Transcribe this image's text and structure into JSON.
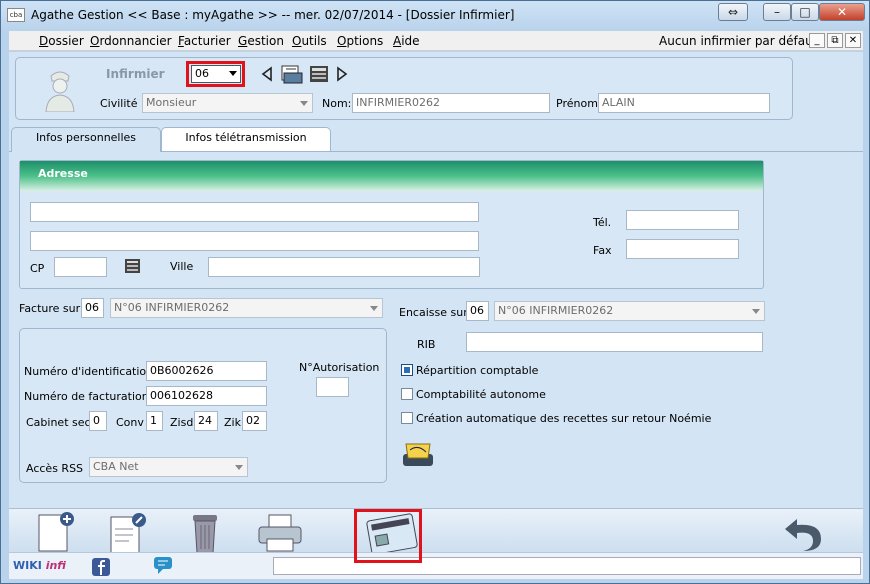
{
  "window": {
    "app_icon": "cba",
    "title": "Agathe Gestion << Base : myAgathe >>   --   mer. 02/07/2014  - [Dossier Infirmier]",
    "extra_button": "⇔",
    "minimize": "–",
    "maximize": "□",
    "close": "✕"
  },
  "menu": {
    "items": [
      {
        "first": "D",
        "rest": "ossier"
      },
      {
        "first": "O",
        "rest": "rdonnancier"
      },
      {
        "first": "F",
        "rest": "acturier"
      },
      {
        "first": "G",
        "rest": "estion"
      },
      {
        "first": "O",
        "rest": "utils"
      },
      {
        "first": "O",
        "rest": "ptions"
      },
      {
        "first": "A",
        "rest": "ide"
      }
    ],
    "default_nurse": "Aucun infirmier par défaut",
    "mdi_min": "_",
    "mdi_restore": "⧉",
    "mdi_close": "✕"
  },
  "header": {
    "title_label": "Infirmier",
    "number": "06",
    "civilite_label": "Civilité",
    "civilite_value": "Monsieur",
    "nom_label": "Nom:",
    "nom_value": "INFIRMIER0262",
    "prenom_label": "Prénom",
    "prenom_value": "ALAIN"
  },
  "tabs": {
    "personal": "Infos personnelles",
    "teletransmission": "Infos télétransmission"
  },
  "address": {
    "header": "Adresse",
    "line1": "",
    "line2": "",
    "cp_label": "CP",
    "cp_value": "",
    "ville_label": "Ville",
    "ville_value": "",
    "tel_label": "Tél.",
    "tel_value": "",
    "fax_label": "Fax",
    "fax_value": ""
  },
  "billing": {
    "facture_label": "Facture sur",
    "facture_num": "06",
    "facture_value": "N°06  INFIRMIER0262",
    "encaisse_label": "Encaisse sur",
    "encaisse_num": "06",
    "encaisse_value": "N°06  INFIRMIER0262",
    "rib_label": "RIB",
    "rib_value": ""
  },
  "ident": {
    "num_id_label": "Numéro d'identification",
    "num_id_value": "0B6002626",
    "num_fact_label": "Numéro de facturation",
    "num_fact_value": "006102628",
    "autorisation_label": "N°Autorisation",
    "autorisation_value": "",
    "cabinet_label": "Cabinet sec.",
    "cabinet_value": "0",
    "conv_label": "Conv",
    "conv_value": "1",
    "zisd_label": "Zisd",
    "zisd_value": "24",
    "zik_label": "Zik",
    "zik_value": "02",
    "rss_label": "Accès RSS",
    "rss_value": "CBA Net"
  },
  "options": {
    "repartition": "Répartition comptable",
    "repartition_checked": true,
    "compta": "Comptabilité autonome",
    "compta_checked": false,
    "creation": "Création automatique des recettes sur retour Noémie",
    "creation_checked": false
  },
  "bottom": {
    "wiki": "WIKI",
    "infi": "infi"
  }
}
